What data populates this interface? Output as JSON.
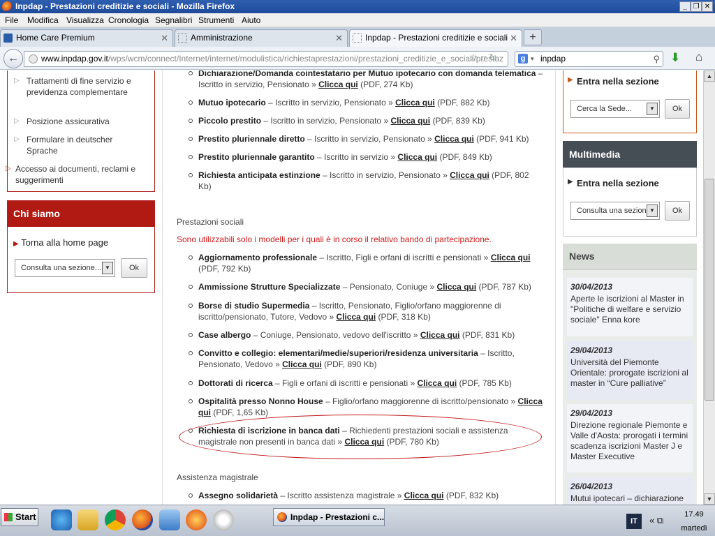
{
  "window": {
    "title": "Inpdap - Prestazioni creditizie e sociali - Mozilla Firefox"
  },
  "menu": [
    "File",
    "Modifica",
    "Visualizza",
    "Cronologia",
    "Segnalibri",
    "Strumenti",
    "Aiuto"
  ],
  "tabs": [
    {
      "label": "Home Care Premium"
    },
    {
      "label": "Amministrazione"
    },
    {
      "label": "Inpdap - Prestazioni creditizie e sociali"
    }
  ],
  "nav": {
    "url_domain": "www.inpdap.gov.it",
    "url_path": "/wps/wcm/connect/Internet/internet/modulistica/richiestaprestazioni/prestazioni_creditizie_e_sociali/prestaz",
    "search_value": "inpdap"
  },
  "left": {
    "subitems": [
      "Trattamenti di fine servizio e previdenza complementare",
      "Posizione assicurativa",
      "Formulare in deutscher Sprache"
    ],
    "access": "Accesso ai documenti, reclami e suggerimenti",
    "chisiamo": {
      "title": "Chi siamo",
      "link": "Torna alla home page",
      "select": "Consulta una sezione...",
      "ok": "Ok"
    }
  },
  "center": {
    "partial_top": {
      "title": "Dichiarazione/Domanda cointestatario per Mutuo ipotecario con domanda telematica",
      "desc": " – Iscritto in servizio, Pensionato » ",
      "link": "Clicca qui",
      "info": " (PDF, 274 Kb)"
    },
    "credit_items": [
      {
        "title": "Mutuo ipotecario",
        "desc": " – Iscritto in servizio, Pensionato » ",
        "link": "Clicca qui",
        "info": " (PDF, 882 Kb)"
      },
      {
        "title": "Piccolo prestito",
        "desc": " – Iscritto in servizio, Pensionato » ",
        "link": "Clicca qui",
        "info": " (PDF, 839 Kb)"
      },
      {
        "title": "Prestito pluriennale diretto",
        "desc": " – Iscritto in servizio, Pensionato » ",
        "link": "Clicca qui",
        "info": " (PDF, 941 Kb)"
      },
      {
        "title": "Prestito pluriennale garantito",
        "desc": " – Iscritto in servizio » ",
        "link": "Clicca qui",
        "info": " (PDF, 849 Kb)"
      },
      {
        "title": "Richiesta anticipata estinzione",
        "desc": " – Iscritto in servizio, Pensionato » ",
        "link": "Clicca qui",
        "info": " (PDF, 802 Kb)"
      }
    ],
    "social_heading": "Prestazioni sociali",
    "social_note": "Sono utilizzabili solo i modelli per i quali è in corso il relativo bando di partecipazione.",
    "social_items": [
      {
        "title": "Aggiornamento professionale",
        "desc": " – Iscritto, Figli e orfani di iscritti e pensionati » ",
        "link": "Clicca qui",
        "info": " (PDF, 792 Kb)"
      },
      {
        "title": "Ammissione Strutture Specializzate",
        "desc": " – Pensionato, Coniuge » ",
        "link": "Clicca qui",
        "info": " (PDF, 787 Kb)"
      },
      {
        "title": "Borse di studio Supermedia",
        "desc": " – Iscritto, Pensionato, Figlio/orfano maggiorenne di iscritto/pensionato, Tutore, Vedovo » ",
        "link": "Clicca qui",
        "info": " (PDF, 318 Kb)"
      },
      {
        "title": "Case albergo",
        "desc": " – Coniuge, Pensionato, vedovo dell'iscritto » ",
        "link": "Clicca qui",
        "info": " (PDF, 831 Kb)"
      },
      {
        "title": "Convitto e collegio: elementari/medie/superiori/residenza universitaria",
        "desc": " – Iscritto, Pensionato, Vedovo » ",
        "link": "Clicca qui",
        "info": " (PDF, 890 Kb)"
      },
      {
        "title": "Dottorati di ricerca",
        "desc": " – Figli e orfani di iscritti e pensionati » ",
        "link": "Clicca qui",
        "info": " (PDF, 785 Kb)"
      },
      {
        "title": "Ospitalità presso Nonno House",
        "desc": " – Figlio/orfano maggiorenne di iscritto/pensionato » ",
        "link": "Clicca qui",
        "info": " (PDF, 1,65 Kb)"
      },
      {
        "title": "Richiesta di iscrizione in banca dati",
        "desc": " – Richiedenti prestazioni sociali e assistenza magistrale non presenti in banca dati » ",
        "link": "Clicca qui",
        "info": " (PDF, 780 Kb)"
      }
    ],
    "mag_heading": "Assistenza magistrale",
    "mag_items": [
      {
        "title": "Assegno solidarietà",
        "desc": " – Iscritto assistenza magistrale » ",
        "link": "Clicca qui",
        "info": " (PDF, 832 Kb)"
      }
    ]
  },
  "right": {
    "sede": {
      "link": "Entra nella sezione",
      "select": "Cerca la Sede...",
      "ok": "Ok"
    },
    "multimedia": {
      "title": "Multimedia",
      "link": "Entra nella sezione",
      "select": "Consulta una sezione...",
      "ok": "Ok"
    },
    "news_title": "News",
    "news": [
      {
        "date": "30/04/2013",
        "text": "Aperte le iscrizioni al Master in \"Politiche di welfare e servizio sociale\" Enna kore"
      },
      {
        "date": "29/04/2013",
        "text": "Università del Piemonte Orientale: prorogate iscrizioni al master in “Cure palliative”"
      },
      {
        "date": "29/04/2013",
        "text": "Direzione regionale Piemonte e Valle d'Aosta: prorogati i termini scadenza iscrizioni Master J e Master Executive"
      },
      {
        "date": "26/04/2013",
        "text": "Mutui ipotecari – dichiarazione"
      }
    ]
  },
  "taskbar": {
    "start": "Start",
    "app": "Inpdap - Prestazioni c...",
    "lang": "IT",
    "time": "17.49",
    "day": "martedì"
  },
  "colors": {
    "brand_red": "#b01a12",
    "multimedia_dark": "#454d55",
    "note_red": "#cc1a1a"
  }
}
